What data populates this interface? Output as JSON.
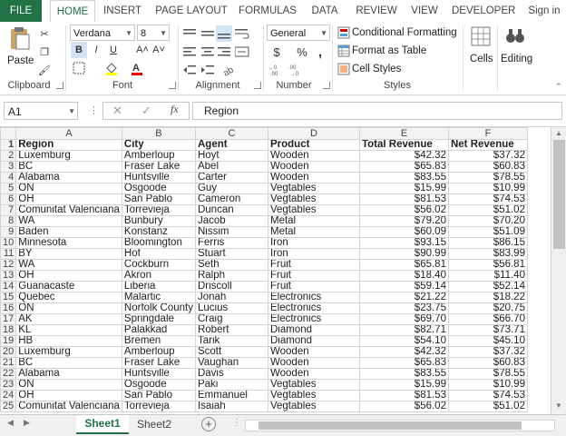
{
  "tabs": [
    "FILE",
    "HOME",
    "INSERT",
    "PAGE LAYOUT",
    "FORMULAS",
    "DATA",
    "REVIEW",
    "VIEW",
    "DEVELOPER",
    "Sign in"
  ],
  "ribbon": {
    "clipboard": {
      "paste": "Paste",
      "label": "Clipboard"
    },
    "font": {
      "name": "Verdana",
      "size": "8",
      "bold": "B",
      "italic": "I",
      "underline": "U",
      "grow": "A˄",
      "shrink": "A˅",
      "label": "Font"
    },
    "alignment": {
      "label": "Alignment"
    },
    "number": {
      "format": "General",
      "currency": "$",
      "percent": "%",
      "comma": ",",
      "label": "Number"
    },
    "styles": {
      "conditional": "Conditional Formatting",
      "table": "Format as Table",
      "cellstyles": "Cell Styles",
      "label": "Styles"
    },
    "cells": {
      "label": "Cells"
    },
    "editing": {
      "label": "Editing"
    }
  },
  "formula_bar": {
    "namebox": "A1",
    "fx": "fx",
    "content": "Region"
  },
  "columns": [
    "A",
    "B",
    "C",
    "D",
    "E",
    "F"
  ],
  "rows": [
    [
      "Region",
      "City",
      "Agent",
      "Product",
      "Total Revenue",
      "Net Revenue"
    ],
    [
      "Luxemburg",
      "Amberloup",
      "Hoyt",
      "Wooden",
      "$42.32",
      "$37.32"
    ],
    [
      "BC",
      "Fraser Lake",
      "Abel",
      "Wooden",
      "$65.83",
      "$60.83"
    ],
    [
      "Alabama",
      "Huntsville",
      "Carter",
      "Wooden",
      "$83.55",
      "$78.55"
    ],
    [
      "ON",
      "Osgoode",
      "Guy",
      "Vegtables",
      "$15.99",
      "$10.99"
    ],
    [
      "OH",
      "San Pablo",
      "Cameron",
      "Vegtables",
      "$81.53",
      "$74.53"
    ],
    [
      "Comunitat Valenciana",
      "Torrevieja",
      "Duncan",
      "Vegtables",
      "$56.02",
      "$51.02"
    ],
    [
      "WA",
      "Bunbury",
      "Jacob",
      "Metal",
      "$79.20",
      "$70.20"
    ],
    [
      "Baden",
      "Konstanz",
      "Nissim",
      "Metal",
      "$60.09",
      "$51.09"
    ],
    [
      "Minnesota",
      "Bloomington",
      "Ferris",
      "Iron",
      "$93.15",
      "$86.15"
    ],
    [
      "BY",
      "Hof",
      "Stuart",
      "Iron",
      "$90.99",
      "$83.99"
    ],
    [
      "WA",
      "Cockburn",
      "Seth",
      "Fruit",
      "$65.81",
      "$56.81"
    ],
    [
      "OH",
      "Akron",
      "Ralph",
      "Fruit",
      "$18.40",
      "$11.40"
    ],
    [
      "Guanacaste",
      "Liberia",
      "Driscoll",
      "Fruit",
      "$59.14",
      "$52.14"
    ],
    [
      "Quebec",
      "Malartic",
      "Jonah",
      "Electronics",
      "$21.22",
      "$18.22"
    ],
    [
      "ON",
      "Norfolk County",
      "Lucius",
      "Electronics",
      "$23.75",
      "$20.75"
    ],
    [
      "AK",
      "Springdale",
      "Craig",
      "Electronics",
      "$69.70",
      "$66.70"
    ],
    [
      "KL",
      "Palakkad",
      "Robert",
      "Diamond",
      "$82.71",
      "$73.71"
    ],
    [
      "HB",
      "Bremen",
      "Tarik",
      "Diamond",
      "$54.10",
      "$45.10"
    ],
    [
      "Luxemburg",
      "Amberloup",
      "Scott",
      "Wooden",
      "$42.32",
      "$37.32"
    ],
    [
      "BC",
      "Fraser Lake",
      "Vaughan",
      "Wooden",
      "$65.83",
      "$60.83"
    ],
    [
      "Alabama",
      "Huntsville",
      "Davis",
      "Wooden",
      "$83.55",
      "$78.55"
    ],
    [
      "ON",
      "Osgoode",
      "Paki",
      "Vegtables",
      "$15.99",
      "$10.99"
    ],
    [
      "OH",
      "San Pablo",
      "Emmanuel",
      "Vegtables",
      "$81.53",
      "$74.53"
    ],
    [
      "Comunitat Valenciana",
      "Torrevieja",
      "Isaiah",
      "Vegtables",
      "$56.02",
      "$51.02"
    ]
  ],
  "sheets": [
    "Sheet1",
    "Sheet2"
  ],
  "colors": {
    "accent": "#217346"
  }
}
